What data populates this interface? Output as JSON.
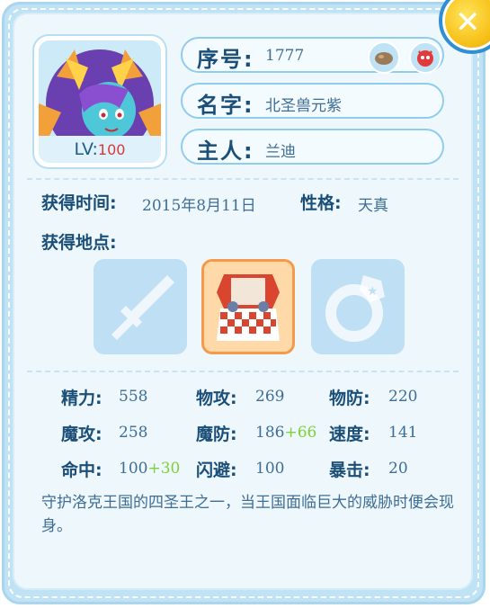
{
  "pet": {
    "level_prefix": "LV:",
    "level": "100",
    "number_label": "序号",
    "number": "1777",
    "name_label": "名字",
    "name": "北圣兽元紫",
    "owner_label": "主人",
    "owner": "兰迪",
    "badges": [
      "rock-type-icon",
      "demon-type-icon"
    ]
  },
  "acquire": {
    "time_label": "获得时间",
    "time": "2015年8月11日",
    "nature_label": "性格",
    "nature": "天真",
    "place_label": "获得地点:"
  },
  "locations": [
    {
      "icon": "sword-icon",
      "selected": false
    },
    {
      "icon": "armor-icon",
      "selected": true
    },
    {
      "icon": "ring-icon",
      "selected": false
    }
  ],
  "stats": {
    "hp_label": "精力",
    "hp": "558",
    "atk_label": "物攻",
    "atk": "269",
    "def_label": "物防",
    "def": "220",
    "matk_label": "魔攻",
    "matk": "258",
    "mdef_label": "魔防",
    "mdef": "186",
    "mdef_bonus": "+66",
    "spd_label": "速度",
    "spd": "141",
    "hit_label": "命中",
    "hit": "100",
    "hit_bonus": "+30",
    "eva_label": "闪避",
    "eva": "100",
    "crit_label": "暴击",
    "crit": "20"
  },
  "description": "守护洛克王国的四圣王之一，当王国面临巨大的威胁时便会现身。",
  "colors": {
    "label": "#1b4f78",
    "value": "#3e6e94",
    "bonus": "#7bd23a",
    "level": "#d23a3a",
    "selected_border": "#f59a4a"
  }
}
